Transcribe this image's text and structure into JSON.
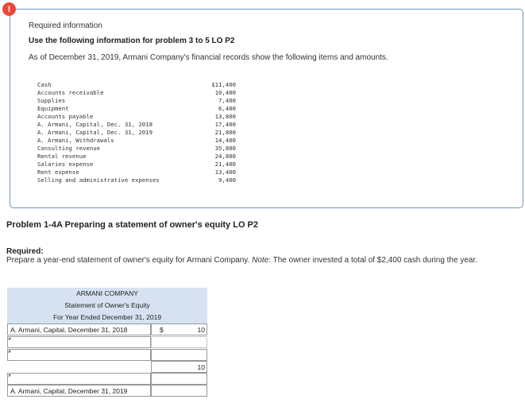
{
  "alert_icon": "!",
  "info": {
    "title": "Required information",
    "subtitle": "Use the following information for problem 3 to 5 LO P2",
    "text": "As of December 31, 2019, Armani Company's financial records show the following items and amounts."
  },
  "items": [
    {
      "label": "Cash",
      "amount": "$11,400"
    },
    {
      "label": "Accounts receivable",
      "amount": "10,400"
    },
    {
      "label": "Supplies",
      "amount": "7,400"
    },
    {
      "label": "Equipment",
      "amount": "6,400"
    },
    {
      "label": "Accounts payable",
      "amount": "13,800"
    },
    {
      "label": "A. Armani, Capital, Dec. 31, 2018",
      "amount": "17,400"
    },
    {
      "label": "A. Armani, Capital, Dec. 31, 2019",
      "amount": "21,800"
    },
    {
      "label": "A. Armani, Withdrawals",
      "amount": "14,400"
    },
    {
      "label": "Consulting revenue",
      "amount": "35,800"
    },
    {
      "label": "Rental revenue",
      "amount": "24,800"
    },
    {
      "label": "Salaries expense",
      "amount": "21,400"
    },
    {
      "label": "Rent expense",
      "amount": "13,400"
    },
    {
      "label": "Selling and administrative expenses",
      "amount": "9,400"
    }
  ],
  "problem": {
    "title": "Problem 1-4A Preparing a statement of owner's equity LO P2",
    "required_label": "Required:",
    "required_text": "Prepare a year-end statement of owner's equity for Armani Company.",
    "note_label": "Note:",
    "note_text": "The owner invested a total of $2,400 cash during the year."
  },
  "statement": {
    "company": "ARMANI COMPANY",
    "title": "Statement of Owner's Equity",
    "period": "For Year Ended December 31, 2019",
    "row1_label": "A. Armani, Capital, December 31, 2018",
    "row1_currency": "$",
    "row1_value": "10",
    "row4_value": "10",
    "row6_label": "A. Armani, Capital, December 31, 2019"
  }
}
